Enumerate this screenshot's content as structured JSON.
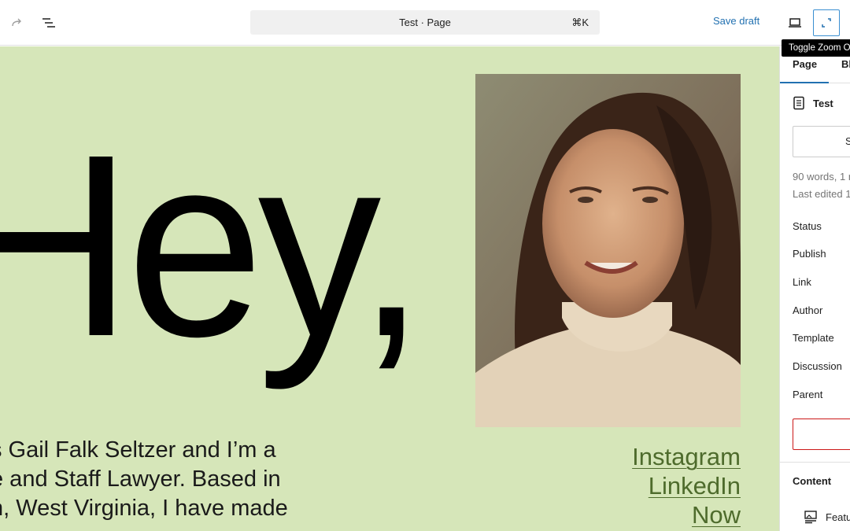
{
  "toolbar": {
    "redo_icon": "redo-icon",
    "list_view_icon": "list-view-icon",
    "command_bar": {
      "title": "Test · Page",
      "shortcut": "⌘K"
    },
    "save_draft_label": "Save draft",
    "device_preview_icon": "laptop-icon",
    "zoom_toggle_icon": "zoom-out-icon",
    "tooltip": "Toggle Zoom Out"
  },
  "canvas": {
    "background": "#d6e6b9",
    "heading": "Hey,",
    "bio_lines": [
      "s Gail Falk Seltzer and I’m a",
      "e and Staff Lawyer. Based in",
      "n, West Virginia, I have made"
    ],
    "photo_alt": "Portrait of a smiling woman with long dark hair",
    "links": [
      "Instagram",
      "LinkedIn",
      "Now"
    ],
    "link_color": "#4e6b2c"
  },
  "sidebar": {
    "tabs": [
      {
        "label": "Page",
        "active": true
      },
      {
        "label": "Bl"
      }
    ],
    "post_title": "Test",
    "summary_button_label": "S",
    "meta": [
      "90 words, 1 r",
      "Last edited 1"
    ],
    "fields": [
      "Status",
      "Publish",
      "Link",
      "Author",
      "Template",
      "Discussion",
      "Parent"
    ],
    "content_section": "Content",
    "featured_image_label": "Featu"
  }
}
